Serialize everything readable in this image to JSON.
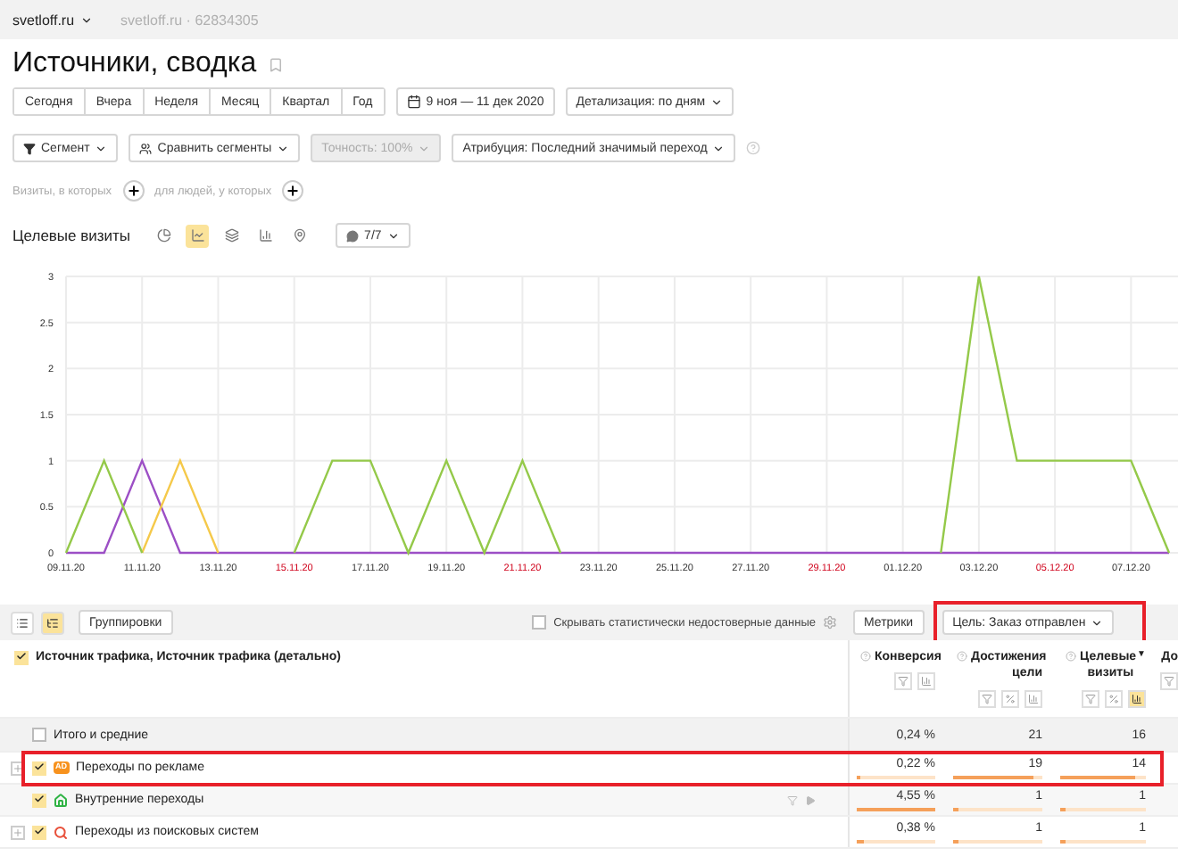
{
  "top_bar": {
    "site": "svetloff.ru",
    "counter": "svetloff.ru · 62834305"
  },
  "title": "Источники, сводка",
  "periods": [
    {
      "label": "Сегодня",
      "selected": false
    },
    {
      "label": "Вчера",
      "selected": false
    },
    {
      "label": "Неделя",
      "selected": false
    },
    {
      "label": "Месяц",
      "selected": false
    },
    {
      "label": "Квартал",
      "selected": false
    },
    {
      "label": "Год",
      "selected": false
    }
  ],
  "date_range": "9 ноя — 11 дек 2020",
  "detail": "Детализация: по дням",
  "filters": [
    {
      "kind": "segment",
      "label": "Сегмент",
      "disabled": false
    },
    {
      "kind": "compare",
      "label": "Сравнить сегменты",
      "disabled": false
    },
    {
      "kind": "plain",
      "label": "Точность: 100%",
      "disabled": true
    },
    {
      "kind": "plain",
      "label": "Атрибуция: Последний значимый переход",
      "disabled": false
    }
  ],
  "conditions": [
    "Визиты, в которых",
    "для людей, у которых"
  ],
  "chart": {
    "title": "Целевые визиты",
    "views": [
      {
        "kind": "pie",
        "selected": false
      },
      {
        "kind": "line",
        "selected": true
      },
      {
        "kind": "area",
        "selected": false
      },
      {
        "kind": "bar",
        "selected": false
      },
      {
        "kind": "map",
        "selected": false
      }
    ],
    "series_count": "7/7",
    "holiday_ticks": [
      false,
      false,
      false,
      true,
      false,
      false,
      true,
      false,
      false,
      false,
      true,
      false,
      false,
      true,
      false
    ],
    "chart_data": {
      "type": "line",
      "grid": true,
      "categories": [
        "09.11.20",
        null,
        "11.11.20",
        null,
        "13.11.20",
        null,
        "15.11.20",
        null,
        "17.11.20",
        null,
        "19.11.20",
        null,
        "21.11.20",
        null,
        "23.11.20",
        null,
        "25.11.20",
        null,
        "27.11.20",
        null,
        "29.11.20",
        null,
        "01.12.20",
        null,
        "03.12.20",
        null,
        "05.12.20",
        null,
        "07.12.20",
        null
      ],
      "series": [
        {
          "color": "#9c4fc5",
          "values": [
            0,
            0,
            1,
            0,
            0,
            0,
            0,
            0,
            0,
            0,
            0,
            0,
            0,
            0,
            0,
            0,
            0,
            0,
            0,
            0,
            0,
            0,
            0,
            0,
            0,
            0,
            0,
            0,
            0,
            0
          ]
        },
        {
          "color": "#f5c94a",
          "values": [
            null,
            null,
            0,
            1,
            0,
            null,
            null,
            null,
            null,
            null,
            null,
            null,
            null,
            null,
            null,
            null,
            null,
            null,
            null,
            null,
            null,
            null,
            null,
            null,
            null,
            null,
            null,
            null,
            null,
            null
          ]
        },
        {
          "color": "#94c949",
          "values": [
            0,
            1,
            0,
            null,
            null,
            null,
            0,
            1,
            1,
            0,
            1,
            0,
            1,
            0,
            null,
            null,
            null,
            null,
            null,
            null,
            null,
            null,
            null,
            0,
            3,
            1,
            1,
            1,
            1,
            0
          ]
        }
      ],
      "yticks": [
        0,
        {
          "value": 0.5,
          "label": "0.5"
        },
        1,
        {
          "value": 1.5,
          "label": "1.5"
        },
        2,
        {
          "value": 2.5,
          "label": "2.5"
        },
        3
      ],
      "ylim": [
        0,
        3
      ]
    }
  },
  "table": {
    "toolbar": {
      "views": [
        {
          "kind": "flat",
          "selected": false
        },
        {
          "kind": "tree",
          "selected": true
        }
      ],
      "groupings": "Группировки",
      "hide_unreliable": {
        "label": "Скрывать статистически недостоверные данные",
        "checked": false
      },
      "metrics": "Метрики",
      "goal": {
        "label": "Цель: Заказ отправлен",
        "highlighted": true
      }
    },
    "dimension": {
      "label": "Источник трафика, Источник трафика (детально)",
      "checked": true
    },
    "columns": [
      {
        "label": "Конверсия",
        "info": true,
        "tools": [
          {
            "kind": "filter",
            "selected": false
          },
          {
            "kind": "chart",
            "selected": false
          }
        ]
      },
      {
        "label": "Достижения цели",
        "info": true,
        "tools": [
          {
            "kind": "filter",
            "selected": false
          },
          {
            "kind": "percent",
            "selected": false
          },
          {
            "kind": "chart",
            "selected": false
          }
        ]
      },
      {
        "label": "Целевые визиты",
        "info": true,
        "sort_mark": "▼",
        "tools": [
          {
            "kind": "filter",
            "selected": false
          },
          {
            "kind": "percent",
            "selected": false
          },
          {
            "kind": "chart",
            "selected": true
          }
        ]
      },
      {
        "label": "До",
        "info": false,
        "tools": [
          {
            "kind": "filter",
            "selected": false
          }
        ]
      }
    ],
    "rows": [
      {
        "label": "Итого и средние",
        "kind": "total",
        "checked": false,
        "expandable": false,
        "highlighted": false,
        "cells": [
          {
            "text": "0,24 %"
          },
          {
            "text": "21"
          },
          {
            "text": "16"
          }
        ]
      },
      {
        "label": "Переходы по рекламе",
        "kind": "ad",
        "badge": "AD",
        "checked": true,
        "expandable": true,
        "highlighted": true,
        "cells": [
          {
            "text": "0,22 %",
            "level": 0.05
          },
          {
            "text": "19",
            "level": 0.9
          },
          {
            "text": "14",
            "level": 0.88
          }
        ]
      },
      {
        "label": "Внутренние переходы",
        "kind": "internal",
        "checked": true,
        "expandable": false,
        "highlighted": false,
        "hover_tools": true,
        "cells": [
          {
            "text": "4,55 %",
            "level": 1
          },
          {
            "text": "1",
            "level": 0.05
          },
          {
            "text": "1",
            "level": 0.06
          }
        ]
      },
      {
        "label": "Переходы из поисковых систем",
        "kind": "search",
        "checked": true,
        "expandable": true,
        "highlighted": false,
        "cells": [
          {
            "text": "0,38 %",
            "level": 0.08
          },
          {
            "text": "1",
            "level": 0.05
          },
          {
            "text": "1",
            "level": 0.06
          }
        ]
      }
    ]
  }
}
